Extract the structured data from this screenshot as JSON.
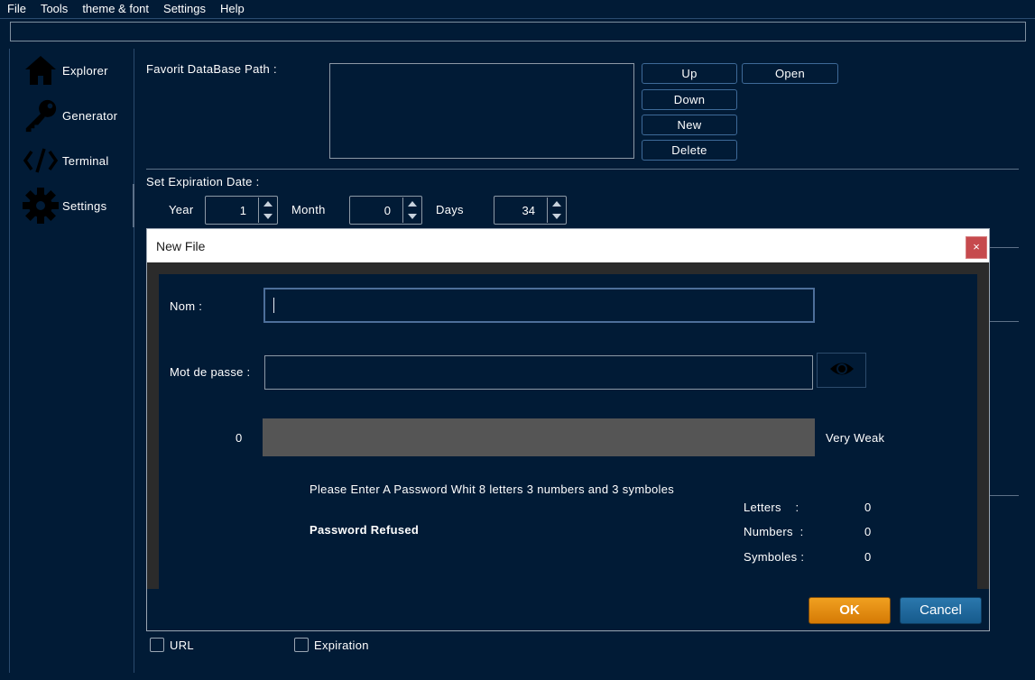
{
  "menu": [
    "File",
    "Tools",
    "theme & font",
    "Settings",
    "Help"
  ],
  "sidebar": {
    "items": [
      {
        "label": "Explorer",
        "icon": "home-icon"
      },
      {
        "label": "Generator",
        "icon": "key-icon"
      },
      {
        "label": "Terminal",
        "icon": "code-icon"
      },
      {
        "label": "Settings",
        "icon": "gear-icon"
      }
    ],
    "active": "Settings"
  },
  "settings": {
    "favorit_label": "Favorit DataBase Path :",
    "buttons": {
      "up": "Up",
      "open": "Open",
      "down": "Down",
      "new": "New",
      "delete": "Delete"
    },
    "expiration_label": "Set Expiration Date :",
    "year_label": "Year",
    "year_value": "1",
    "month_label": "Month",
    "month_value": "0",
    "days_label": "Days",
    "days_value": "34",
    "checkbox_url": "URL",
    "checkbox_expiration": "Expiration"
  },
  "dialog": {
    "title": "New File",
    "close": "×",
    "name_label": "Nom :",
    "name_value": "",
    "password_label": "Mot de passe :",
    "password_value": "",
    "strength_score": "0",
    "strength_text": "Very Weak",
    "hint": "Please Enter A Password Whit 8 letters 3 numbers and 3 symboles",
    "status": "Password Refused",
    "stats": {
      "letters_label": "Letters    :",
      "letters_value": "0",
      "numbers_label": "Numbers  :",
      "numbers_value": "0",
      "symboles_label": "Symboles :",
      "symboles_value": "0"
    },
    "ok": "OK",
    "cancel": "Cancel"
  },
  "colors": {
    "background": "#011b36",
    "ok": "#e68a10",
    "cancel": "#1e6a9e",
    "close": "#c64a4d"
  }
}
